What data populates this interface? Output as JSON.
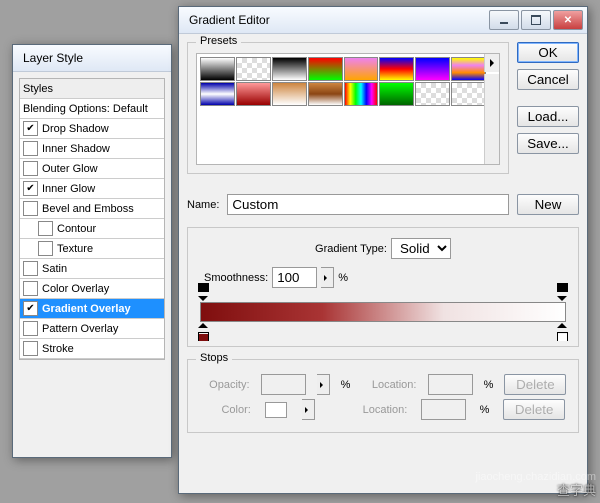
{
  "layerStyle": {
    "title": "Layer Style",
    "header": "Styles",
    "blending": "Blending Options: Default",
    "items": [
      {
        "label": "Drop Shadow",
        "checked": true,
        "indent": false
      },
      {
        "label": "Inner Shadow",
        "checked": false,
        "indent": false
      },
      {
        "label": "Outer Glow",
        "checked": false,
        "indent": false
      },
      {
        "label": "Inner Glow",
        "checked": true,
        "indent": false
      },
      {
        "label": "Bevel and Emboss",
        "checked": false,
        "indent": false
      },
      {
        "label": "Contour",
        "checked": false,
        "indent": true
      },
      {
        "label": "Texture",
        "checked": false,
        "indent": true
      },
      {
        "label": "Satin",
        "checked": false,
        "indent": false
      },
      {
        "label": "Color Overlay",
        "checked": false,
        "indent": false
      },
      {
        "label": "Gradient Overlay",
        "checked": true,
        "indent": false,
        "selected": true
      },
      {
        "label": "Pattern Overlay",
        "checked": false,
        "indent": false
      },
      {
        "label": "Stroke",
        "checked": false,
        "indent": false
      }
    ]
  },
  "gradientEditor": {
    "title": "Gradient Editor",
    "presets_label": "Presets",
    "name_label": "Name:",
    "name_value": "Custom",
    "gradient_type_label": "Gradient Type:",
    "gradient_type_value": "Solid",
    "smoothness_label": "Smoothness:",
    "smoothness_value": "100",
    "percent": "%",
    "stops_label": "Stops",
    "opacity_label": "Opacity:",
    "color_label": "Color:",
    "location_label": "Location:",
    "buttons": {
      "ok": "OK",
      "cancel": "Cancel",
      "load": "Load...",
      "save": "Save...",
      "new": "New",
      "delete": "Delete"
    },
    "swatches": [
      "linear-gradient(#fff,#000)",
      "check",
      "linear-gradient(#000,#fff)",
      "linear-gradient(#ff0000,#00ff00)",
      "linear-gradient(#ee82ee,#ffa500)",
      "linear-gradient(#0000ff,#ff0000,#ffff00)",
      "linear-gradient(#0000ff,#ff00ff)",
      "linear-gradient(#ffff00,#ee82ee,#ff8c00,#00f)",
      "linear-gradient(#00a,#fff,#00a)",
      "linear-gradient(#ff9999,#990000)",
      "linear-gradient(#cd853f,#fff)",
      "linear-gradient(#cd853f,#8b4513,#fff)",
      "linear-gradient(90deg,#f00,#ff0,#0f0,#0ff,#00f,#f0f,#f00)",
      "linear-gradient(#0f0,#006400)",
      "check",
      "check"
    ],
    "gradient_colors": {
      "left": "#7f0e0e",
      "right": "#ffffff"
    }
  },
  "watermark": {
    "main": "查字典",
    "sub": "jiaocheng.chazidian.com"
  }
}
